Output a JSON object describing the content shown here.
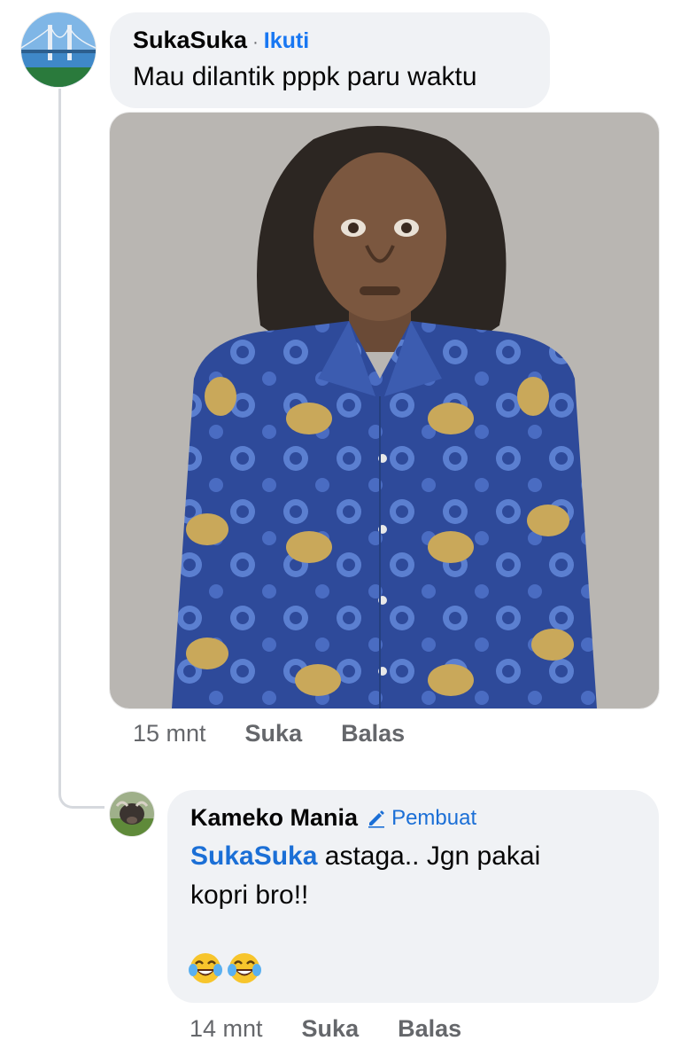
{
  "comment": {
    "author": "SukaSuka",
    "separator": "·",
    "follow_label": "Ikuti",
    "text": "Mau dilantik pppk paru waktu",
    "time": "15 mnt",
    "like_label": "Suka",
    "reply_label": "Balas",
    "avatar_icon": "bridge-landscape-avatar",
    "image_icon": "person-in-blue-batik-shirt-photo"
  },
  "reply": {
    "author": "Kameko Mania",
    "badge_label": "Pembuat",
    "badge_icon": "pencil-icon",
    "mention": "SukaSuka",
    "text_line1": "astaga.. Jgn pakai",
    "text_line2": "kopri bro!!",
    "emojis": "😂😂",
    "time": "14 mnt",
    "like_label": "Suka",
    "reply_label": "Balas",
    "avatar_icon": "buffalo-avatar"
  },
  "colors": {
    "bubble": "#f0f2f5",
    "link": "#1877f2",
    "meta": "#65676b",
    "text": "#050505"
  }
}
